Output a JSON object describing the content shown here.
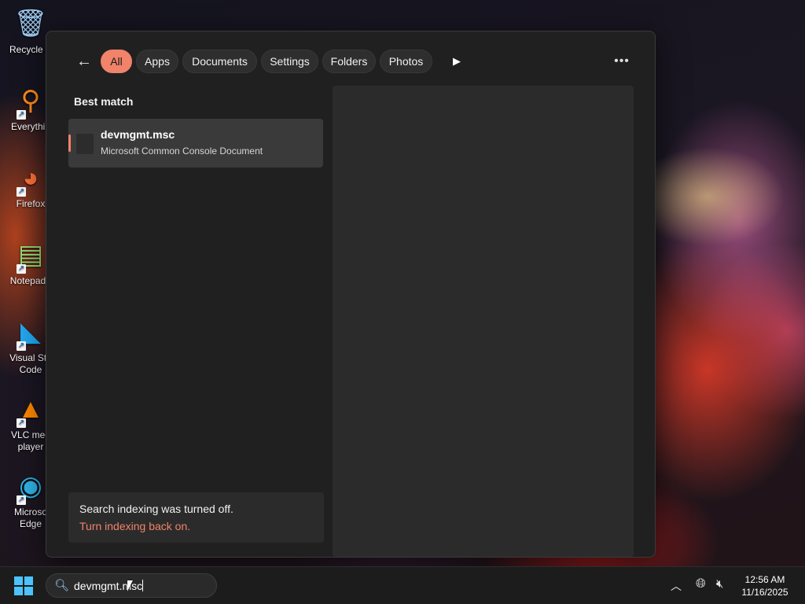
{
  "desktop": {
    "icons": [
      {
        "label": "Recycle B",
        "icon": "recycle-bin-icon",
        "glyph": "🗑"
      },
      {
        "label": "Everythin",
        "icon": "everything-search-icon",
        "glyph": "🔍"
      },
      {
        "label": "Firefox",
        "icon": "firefox-icon",
        "glyph": "🦊"
      },
      {
        "label": "Notepad+",
        "icon": "notepad-plus-icon",
        "glyph": "📝"
      },
      {
        "label": "Visual Stu\nCode",
        "icon": "vscode-icon",
        "glyph": "❮❯"
      },
      {
        "label": "VLC med\nplayer",
        "icon": "vlc-icon",
        "glyph": "🔺"
      },
      {
        "label": "Microso\nEdge",
        "icon": "edge-icon",
        "glyph": "◉"
      }
    ]
  },
  "search_flyout": {
    "filters": [
      "All",
      "Apps",
      "Documents",
      "Settings",
      "Folders",
      "Photos"
    ],
    "active_filter": "All",
    "section_label": "Best match",
    "best_match": {
      "title": "devmgmt.msc",
      "subtitle": "Microsoft Common Console Document"
    },
    "notice": {
      "title": "Search indexing was turned off.",
      "link": "Turn indexing back on."
    }
  },
  "taskbar": {
    "search_value": "devmgmt.msc",
    "time": "12:56 AM",
    "date": "11/16/2025"
  },
  "colors": {
    "accent": "#f0836a",
    "flyout_bg": "#202020",
    "start_blue": "#4cc2ff"
  }
}
